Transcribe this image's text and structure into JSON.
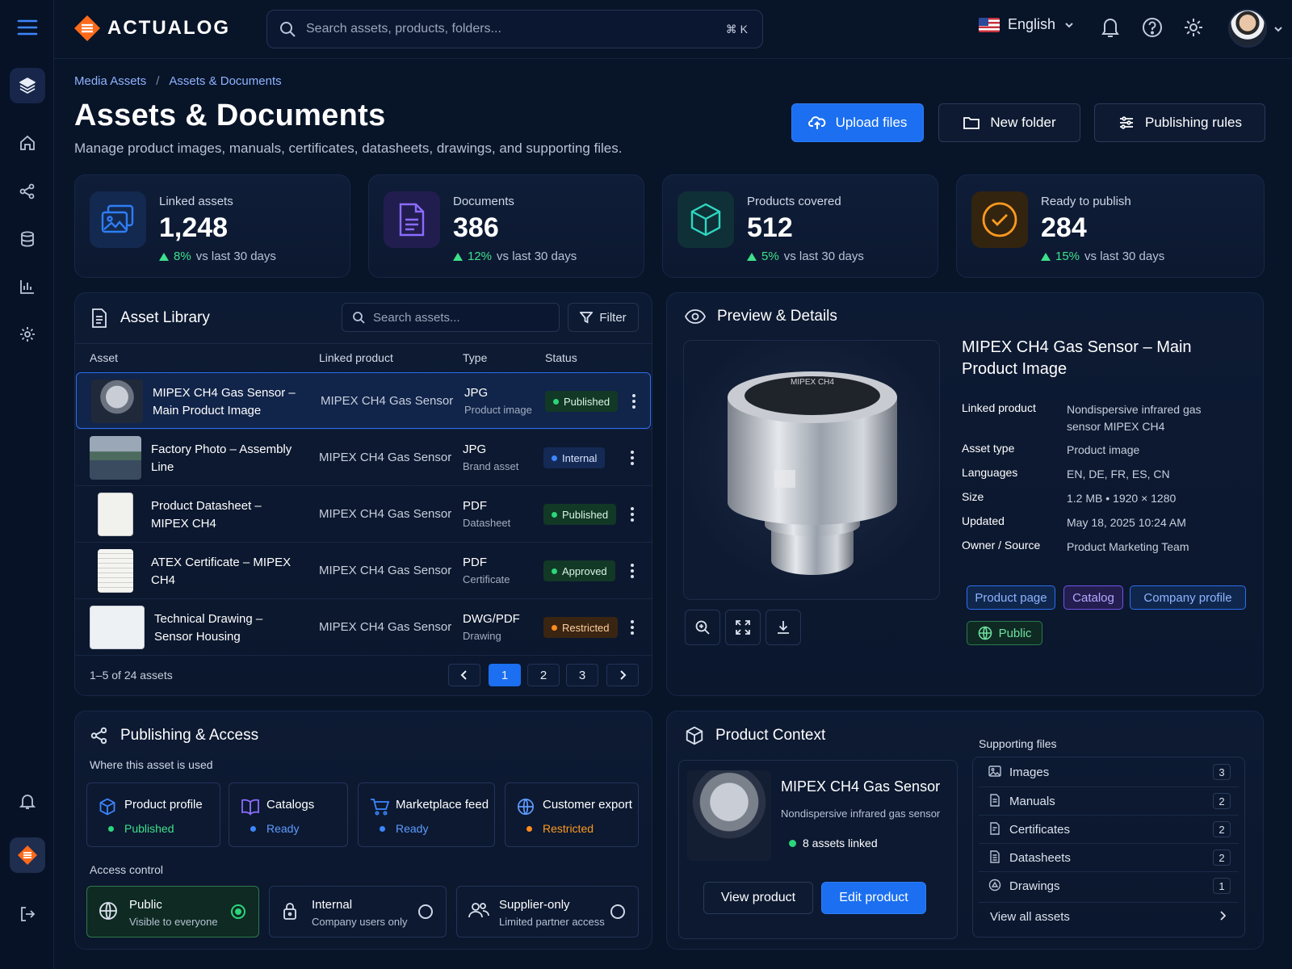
{
  "app": {
    "brand": "ACTUALOG"
  },
  "topbar": {
    "search_placeholder": "Search assets, products, folders...",
    "search_shortcut": "⌘ K",
    "language": "English"
  },
  "breadcrumb": [
    "Media Assets",
    "Assets & Documents"
  ],
  "page": {
    "title": "Assets & Documents",
    "subtitle": "Manage product images, manuals, certificates, datasheets, drawings, and supporting files."
  },
  "actions": {
    "upload": "Upload files",
    "new_folder": "New folder",
    "publishing_rules": "Publishing rules"
  },
  "kpis": [
    {
      "label": "Linked assets",
      "value": "1,248",
      "delta": "8%",
      "period": "vs last 30 days",
      "color": "#2f7df5"
    },
    {
      "label": "Documents",
      "value": "386",
      "delta": "12%",
      "period": "vs last 30 days",
      "color": "#8b6cff"
    },
    {
      "label": "Products covered",
      "value": "512",
      "delta": "5%",
      "period": "vs last 30 days",
      "color": "#2fd6c0"
    },
    {
      "label": "Ready to publish",
      "value": "284",
      "delta": "15%",
      "period": "vs last 30 days",
      "color": "#ff9a1f"
    }
  ],
  "library": {
    "title": "Asset Library",
    "search_placeholder": "Search assets...",
    "filter": "Filter",
    "columns": [
      "Asset",
      "Linked product",
      "Type",
      "Status"
    ],
    "rows": [
      {
        "name": "MIPEX CH4 Gas Sensor – Main Product Image",
        "product": "MIPEX CH4 Gas Sensor",
        "type": "JPG",
        "subtype": "Product image",
        "status": "Published"
      },
      {
        "name": "Factory Photo – Assembly Line",
        "product": "MIPEX CH4 Gas Sensor",
        "type": "JPG",
        "subtype": "Brand asset",
        "status": "Internal"
      },
      {
        "name": "Product Datasheet – MIPEX CH4",
        "product": "MIPEX CH4 Gas Sensor",
        "type": "PDF",
        "subtype": "Datasheet",
        "status": "Published"
      },
      {
        "name": "ATEX Certificate – MIPEX CH4",
        "product": "MIPEX CH4 Gas Sensor",
        "type": "PDF",
        "subtype": "Certificate",
        "status": "Approved"
      },
      {
        "name": "Technical Drawing – Sensor Housing",
        "product": "MIPEX CH4 Gas Sensor",
        "type": "DWG/PDF",
        "subtype": "Drawing",
        "status": "Restricted"
      }
    ],
    "pagination": {
      "summary": "1–5 of 24 assets",
      "pages": [
        "1",
        "2",
        "3"
      ],
      "current": "1"
    }
  },
  "preview": {
    "title": "Preview & Details",
    "image_label": "MIPEX CH4",
    "asset_title": "MIPEX CH4 Gas Sensor – Main Product Image",
    "details": [
      {
        "key": "Linked product",
        "value": "Nondispersive infrared gas sensor MIPEX CH4"
      },
      {
        "key": "Asset type",
        "value": "Product image"
      },
      {
        "key": "Languages",
        "value": "EN, DE, FR, ES, CN"
      },
      {
        "key": "Size",
        "value": "1.2 MB  •  1920 × 1280"
      },
      {
        "key": "Updated",
        "value": "May 18, 2025 10:24 AM"
      },
      {
        "key": "Owner / Source",
        "value": "Product Marketing Team"
      }
    ],
    "channels": [
      "Product page",
      "Catalog",
      "Company profile"
    ],
    "visibility": "Public"
  },
  "publishing": {
    "title": "Publishing & Access",
    "usage_label": "Where this asset is used",
    "usage": [
      {
        "name": "Product profile",
        "status": "Published"
      },
      {
        "name": "Catalogs",
        "status": "Ready"
      },
      {
        "name": "Marketplace feed",
        "status": "Ready"
      },
      {
        "name": "Customer export",
        "status": "Restricted"
      }
    ],
    "access_label": "Access control",
    "access": [
      {
        "name": "Public",
        "desc": "Visible to everyone",
        "selected": true
      },
      {
        "name": "Internal",
        "desc": "Company users only",
        "selected": false
      },
      {
        "name": "Supplier-only",
        "desc": "Limited partner access",
        "selected": false
      }
    ]
  },
  "context": {
    "title": "Product Context",
    "product_name": "MIPEX CH4 Gas Sensor",
    "product_desc": "Nondispersive infrared gas sensor",
    "linked": "8 assets linked",
    "view_product": "View product",
    "edit_product": "Edit product",
    "supporting_title": "Supporting files",
    "supporting": [
      {
        "label": "Images",
        "count": "3"
      },
      {
        "label": "Manuals",
        "count": "2"
      },
      {
        "label": "Certificates",
        "count": "2"
      },
      {
        "label": "Datasheets",
        "count": "2"
      },
      {
        "label": "Drawings",
        "count": "1"
      }
    ],
    "view_all": "View all assets"
  }
}
